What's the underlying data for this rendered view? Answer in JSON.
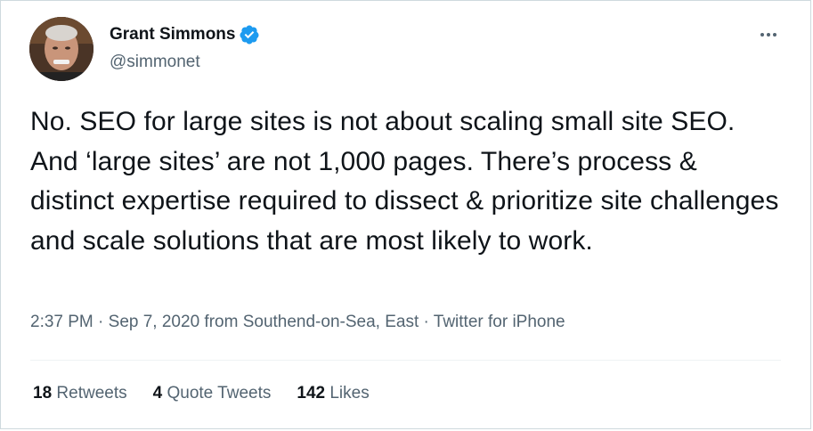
{
  "author": {
    "display_name": "Grant Simmons",
    "handle": "@simmonet",
    "verified": true
  },
  "tweet": {
    "text": "No. SEO for large sites is not about scaling small site SEO. And ‘large sites’ are not 1,000 pages. There’s process & distinct expertise required to dissect & prioritize site challenges and scale solutions that are most likely to work.",
    "time": "2:37 PM",
    "date": "Sep 7, 2020",
    "from_prefix": "from",
    "location": "Southend-on-Sea, East",
    "source": "Twitter for iPhone",
    "separator": "·"
  },
  "stats": {
    "retweets": {
      "count": "18",
      "label": "Retweets"
    },
    "quotes": {
      "count": "4",
      "label": "Quote Tweets"
    },
    "likes": {
      "count": "142",
      "label": "Likes"
    }
  },
  "colors": {
    "text": "#0f1419",
    "secondary": "#536471",
    "verified_blue": "#1d9bf0",
    "border": "#cfd9de"
  },
  "icons": {
    "verified": "verified-badge-icon",
    "more": "more-dots-icon"
  }
}
